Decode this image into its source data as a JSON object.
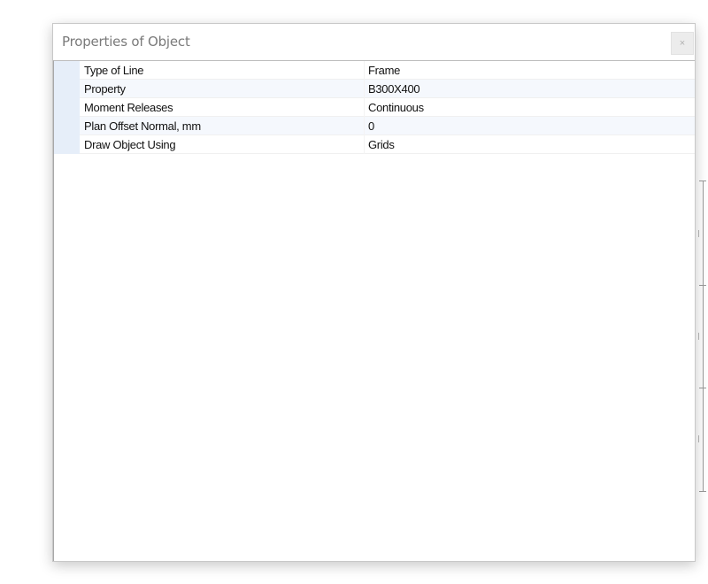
{
  "dialog": {
    "title": "Properties of Object",
    "close_glyph": "×",
    "close_icon": "close-icon"
  },
  "properties": [
    {
      "label": "Type of Line",
      "value": "Frame"
    },
    {
      "label": "Property",
      "value": "B300X400"
    },
    {
      "label": "Moment Releases",
      "value": "Continuous"
    },
    {
      "label": "Plan Offset Normal, mm",
      "value": "0"
    },
    {
      "label": "Draw Object Using",
      "value": "Grids"
    }
  ],
  "colors": {
    "title_text": "#7a7a7a",
    "row_gutter": "#e6eef9",
    "row_alt": "#f5f8fd"
  }
}
